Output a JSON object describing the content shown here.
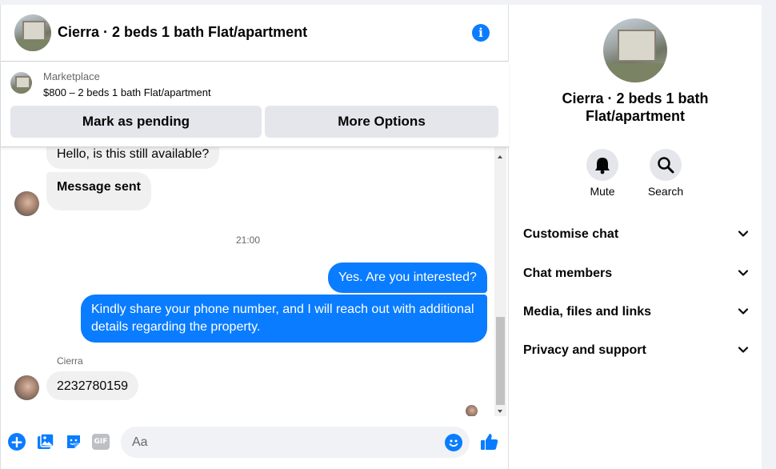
{
  "header": {
    "title": "Cierra · 2 beds 1 bath Flat/apartment"
  },
  "listing": {
    "source": "Marketplace",
    "price_line": "$800 – 2 beds 1 bath Flat/apartment",
    "mark_pending_label": "Mark as pending",
    "more_options_label": "More Options"
  },
  "messages": {
    "incoming_1": "Hello, is this still available?",
    "incoming_2": "Message sent",
    "timestamp": "21:00",
    "outgoing_1": "Yes. Are you interested?",
    "outgoing_2": "Kindly share your phone number, and I will reach out with additional details regarding the property.",
    "sender_name": "Cierra",
    "incoming_3": "2232780159"
  },
  "composer": {
    "placeholder": "Aa",
    "gif_label": "GIF"
  },
  "side": {
    "title": "Cierra · 2 beds 1 bath Flat/apartment",
    "mute_label": "Mute",
    "search_label": "Search",
    "sections": [
      "Customise chat",
      "Chat members",
      "Media, files and links",
      "Privacy and support"
    ]
  },
  "colors": {
    "accent": "#0a7cff",
    "bubble_in": "#f0f0f0",
    "button_bg": "#e4e6eb"
  }
}
